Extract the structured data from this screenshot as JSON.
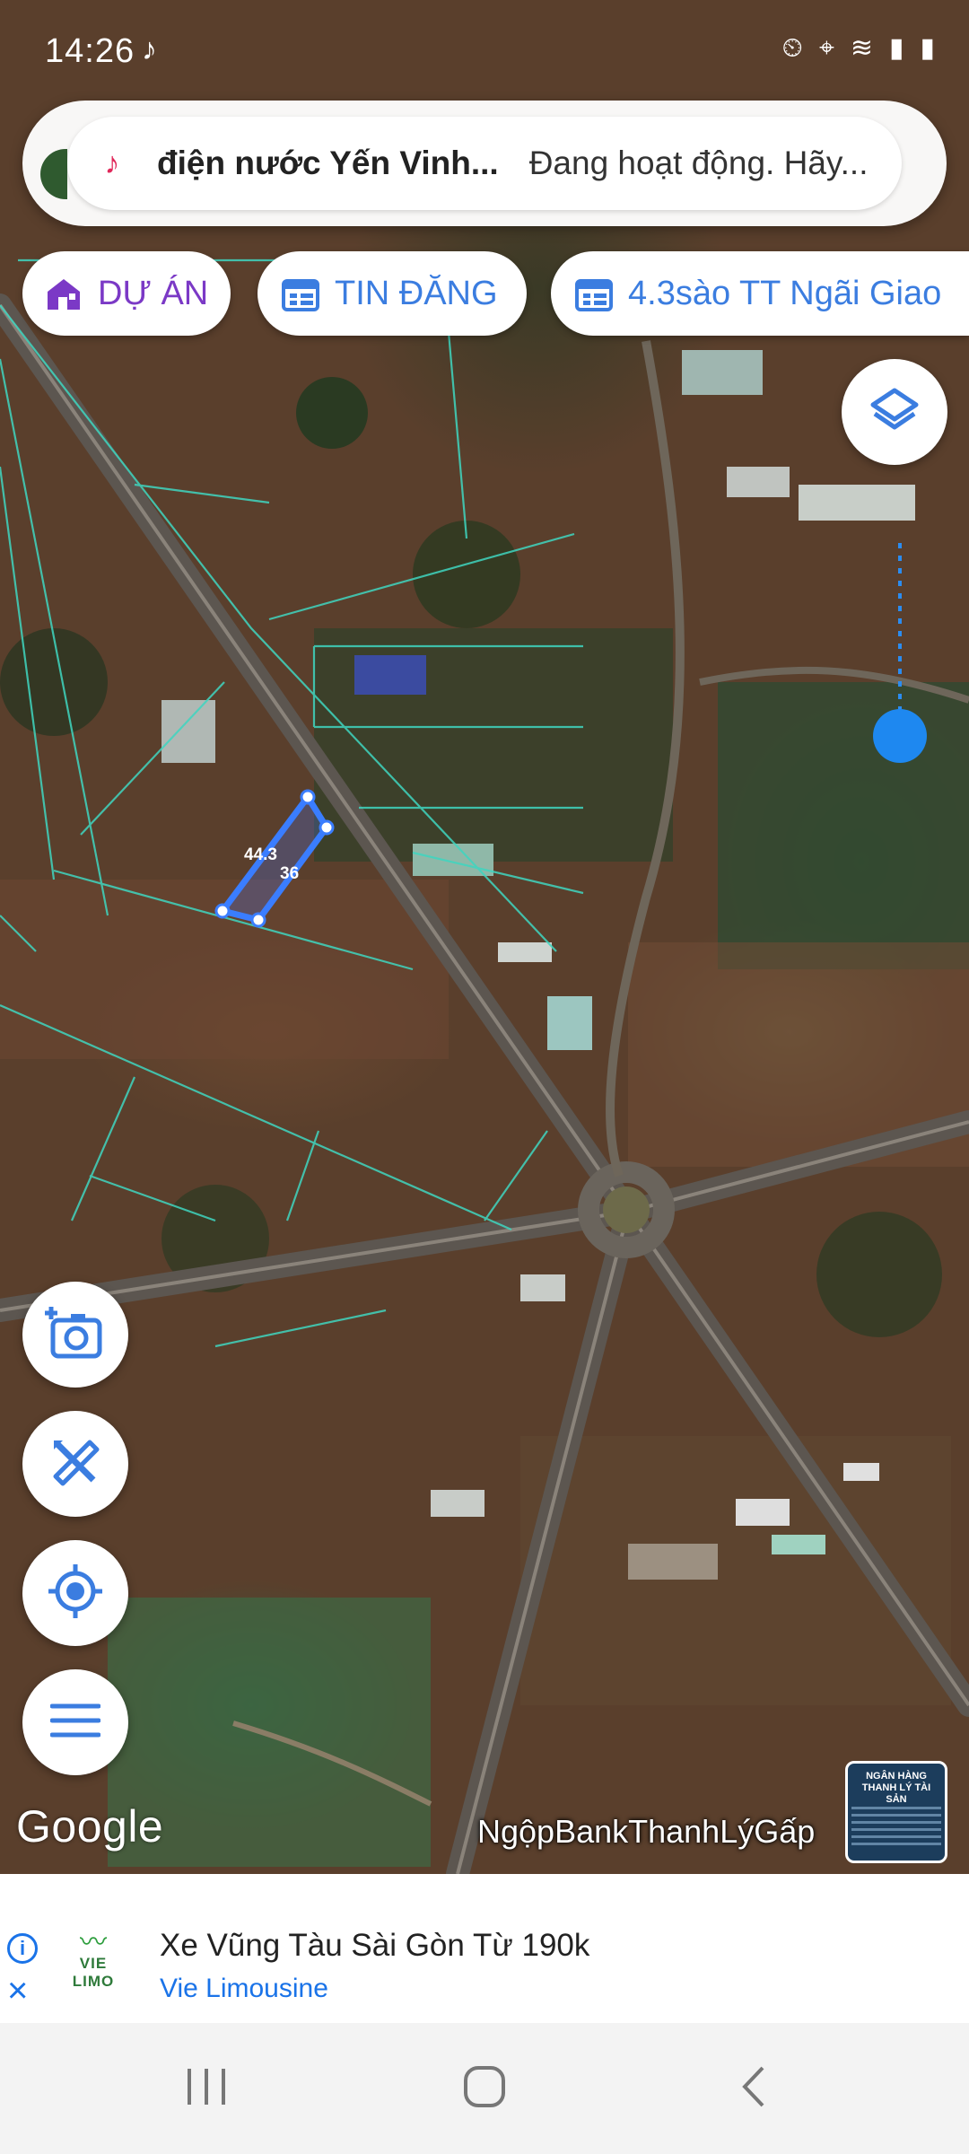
{
  "status_bar": {
    "time": "14:26"
  },
  "notification": {
    "title": "điện nước Yến Vinh...",
    "message": "Đang hoạt động. Hãy..."
  },
  "chips": {
    "du_an": "DỰ ÁN",
    "tin_dang": "TIN ĐĂNG",
    "listing": "4.3sào TT Ngãi Giao"
  },
  "map": {
    "parcel_labels": [
      "44.3",
      "36"
    ],
    "google_logo": "Google",
    "watermark": "NgộpBankThanhLýGấp",
    "thumbnail_text": "NGÂN HÀNG THANH LÝ TÀI SẢN"
  },
  "ad": {
    "logo_text": "VIE LIMO",
    "headline": "Xe Vũng Tàu Sài Gòn Từ 190k",
    "advertiser": "Vie Limousine"
  },
  "colors": {
    "accent": "#2f7fe0",
    "chip_text": "#3b7de0",
    "parcel": "#3a7dff",
    "ad_link": "#1a73e8"
  }
}
